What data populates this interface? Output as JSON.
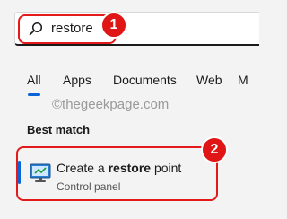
{
  "search": {
    "value": "restore",
    "placeholder": ""
  },
  "badges": {
    "first": "1",
    "second": "2"
  },
  "tabs": [
    {
      "label": "All"
    },
    {
      "label": "Apps"
    },
    {
      "label": "Documents"
    },
    {
      "label": "Web"
    },
    {
      "label": "M"
    }
  ],
  "watermark": "©thegeekpage.com",
  "best_match": {
    "heading": "Best match",
    "result": {
      "title_before": "Create a ",
      "title_bold": "restore",
      "title_after": " point",
      "subtitle": "Control panel"
    }
  },
  "colors": {
    "accent": "#0a64d8",
    "highlight": "#e21a1a",
    "badge": "#e01515"
  },
  "icons": {
    "search": "search-icon",
    "result": "system-restore-monitor-icon"
  }
}
